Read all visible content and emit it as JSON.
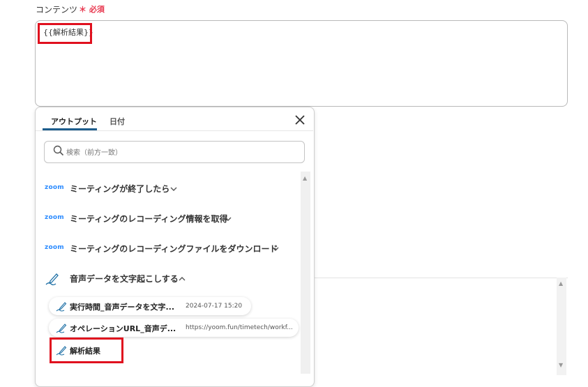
{
  "field": {
    "label": "コンテンツ",
    "required": "＊ 必須",
    "content": "{{解析結果}}"
  },
  "panel": {
    "tabs": [
      {
        "label": "アウトプット"
      },
      {
        "label": "日付"
      }
    ],
    "search": {
      "placeholder": "検索（前方一致）"
    },
    "sections": [
      {
        "app": "zoom",
        "title": "ミーティングが終了したら"
      },
      {
        "app": "zoom",
        "title": "ミーティングのレコーディング情報を取得"
      },
      {
        "app": "zoom",
        "title": "ミーティングのレコーディングファイルをダウンロード"
      },
      {
        "app": "pen-icon",
        "title": "音声データを文字起こしする"
      }
    ],
    "items": [
      {
        "label": "実行時間_音声データを文字...",
        "value": "2024-07-17 15:20"
      },
      {
        "label": "オペレーションURL_音声デ...",
        "value": "https://yoom.fun/timetech/workf..."
      },
      {
        "label": "解析結果",
        "value": ""
      }
    ]
  },
  "colors": {
    "accent": "#1d5c8c",
    "required": "#e8384f",
    "highlight": "#e0101e",
    "zoom": "#2d8cff"
  }
}
